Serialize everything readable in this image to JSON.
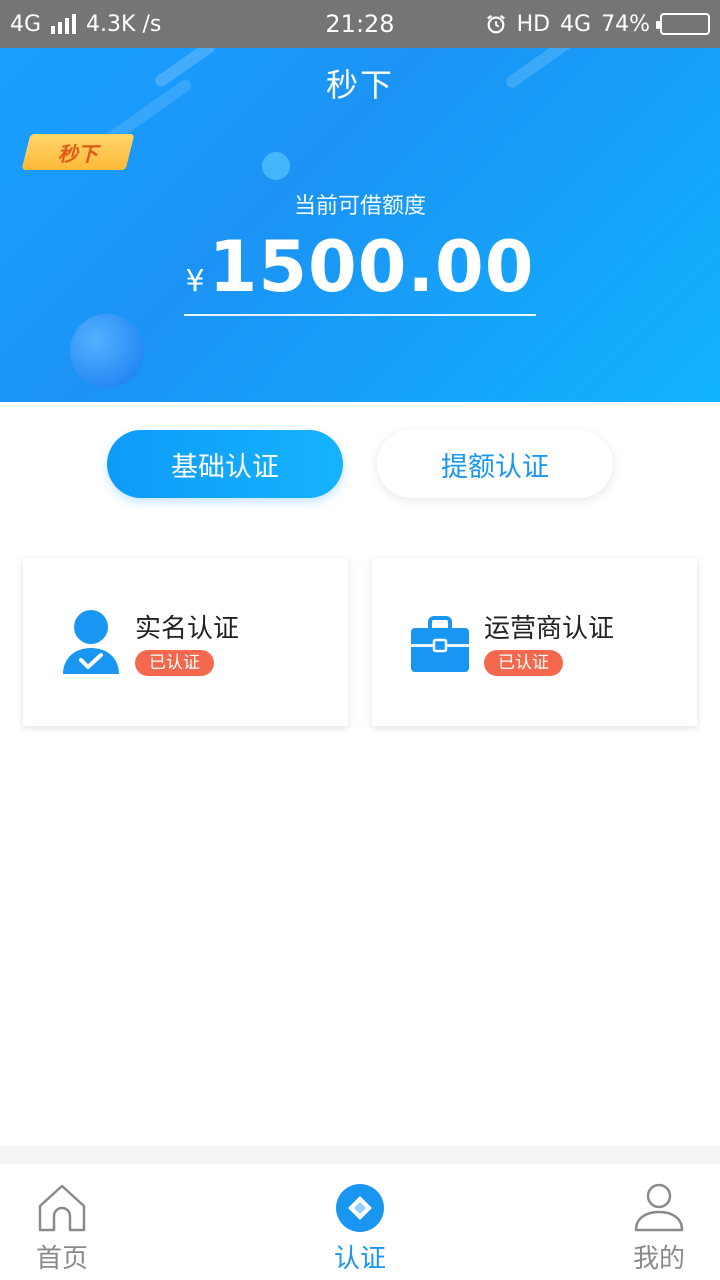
{
  "status_bar": {
    "network": "4G",
    "speed": "4.3K /s",
    "time": "21:28",
    "hd": "HD",
    "network_right": "4G",
    "battery": "74%",
    "battery_level": 0.74
  },
  "header": {
    "title": "秒下",
    "tag": "秒下",
    "credit_label": "当前可借额度",
    "currency": "¥",
    "amount": "1500.00"
  },
  "tabs": [
    {
      "label": "基础认证",
      "active": true
    },
    {
      "label": "提额认证",
      "active": false
    }
  ],
  "cards": [
    {
      "title": "实名认证",
      "status": "已认证",
      "icon": "person-check-icon"
    },
    {
      "title": "运营商认证",
      "status": "已认证",
      "icon": "briefcase-icon"
    }
  ],
  "bottom_nav": [
    {
      "label": "首页",
      "icon": "home-icon",
      "active": false
    },
    {
      "label": "认证",
      "icon": "diamond-badge-icon",
      "active": true
    },
    {
      "label": "我的",
      "icon": "user-icon",
      "active": false
    }
  ],
  "colors": {
    "primary": "#1996f1",
    "status_badge": "#f4694e",
    "tag_gold": "#ffc34d"
  }
}
